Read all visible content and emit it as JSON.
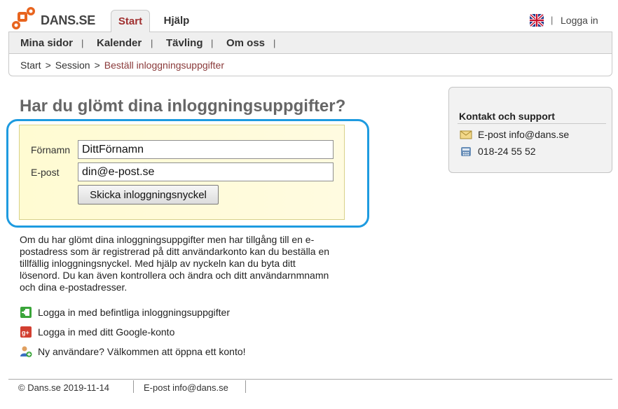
{
  "header": {
    "logo_text": "DANS.SE",
    "tabs": [
      {
        "label": "Start",
        "active": true
      },
      {
        "label": "Hjälp",
        "active": false
      }
    ],
    "separator": "|",
    "login_label": "Logga in",
    "language_icon": "uk-flag-icon"
  },
  "nav": {
    "items": [
      {
        "label": "Mina sidor"
      },
      {
        "label": "Kalender"
      },
      {
        "label": "Tävling"
      },
      {
        "label": "Om oss"
      }
    ],
    "separator": "|"
  },
  "breadcrumb": {
    "items": [
      "Start",
      "Session",
      "Beställ inloggningsuppgifter"
    ],
    "separator": ">"
  },
  "main": {
    "title": "Har du glömt dina inloggningsuppgifter?",
    "form": {
      "first_name_label": "Förnamn",
      "first_name_value": "DittFörnamn",
      "email_label": "E-post",
      "email_value": "din@e-post.se",
      "submit_label": "Skicka inloggningsnyckel"
    },
    "description": "Om du har glömt dina inloggningsuppgifter men har tillgång till en e-postadress som är registrerad på ditt användarkonto kan du beställa en tillfällig inloggningsnyckel. Med hjälp av nyckeln kan du byta ditt lösenord. Du kan även kontrollera och ändra och ditt användarnmnamn och dina e-postadresser.",
    "links": [
      {
        "label": "Logga in med befintliga inloggningsuppgifter",
        "icon": "login-icon"
      },
      {
        "label": "Logga in med ditt Google-konto",
        "icon": "google-plus-icon"
      },
      {
        "label": "Ny användare? Välkommen att öppna ett konto!",
        "icon": "add-user-icon"
      }
    ]
  },
  "sidebar": {
    "title": "Kontakt och support",
    "email": "E-post info@dans.se",
    "phone": "018-24 55 52"
  },
  "footer": {
    "copyright": "© Dans.se 2019-11-14",
    "email": "E-post info@dans.se"
  },
  "colors": {
    "accent_red": "#a03030",
    "focus_blue": "#1e9be0",
    "form_bg": "#fffbd2"
  }
}
